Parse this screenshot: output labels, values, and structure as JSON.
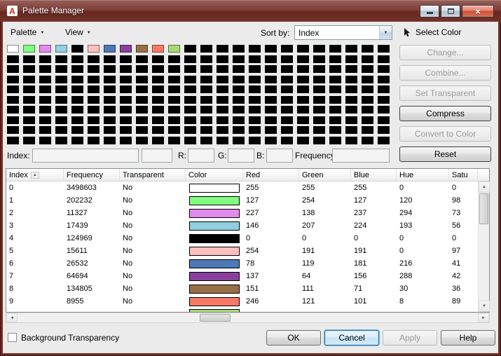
{
  "window": {
    "title": "Palette Manager",
    "icon_letter": "A"
  },
  "icons": {
    "dropdown": "▼",
    "sort_asc": "▲",
    "up": "▲",
    "down": "▼",
    "left": "◄",
    "right": "►",
    "close": "×"
  },
  "menubar": {
    "palette_label": "Palette",
    "view_label": "View",
    "sort_by_label": "Sort by:",
    "sort_value": "Index",
    "select_color_label": "Select Color"
  },
  "palette_grid": {
    "columns": 24,
    "rows": 10,
    "lead_colors": [
      "#FFFFFF",
      "#7FFE7F",
      "#E38AED",
      "#92CFE0",
      "#000000",
      "#FEBFBF",
      "#4E77B5",
      "#89409C",
      "#976F47",
      "#F67965",
      "#A8D878"
    ],
    "fill_color": "#000000"
  },
  "side_buttons": [
    {
      "label": "Change...",
      "enabled": false
    },
    {
      "label": "Combine...",
      "enabled": false
    },
    {
      "label": "Set Transparent",
      "enabled": false
    },
    {
      "label": "Compress",
      "enabled": true
    },
    {
      "label": "Convert to Color",
      "enabled": false
    },
    {
      "label": "Reset",
      "enabled": true
    }
  ],
  "info_bar": {
    "index_label": "Index:",
    "index_value": "",
    "index_count_value": "",
    "r_label": "R:",
    "r_value": "",
    "g_label": "G:",
    "g_value": "",
    "b_label": "B:",
    "b_value": "",
    "frequency_label": "Frequency:",
    "frequency_value": ""
  },
  "table": {
    "columns": [
      "Index",
      "Frequency",
      "Transparent",
      "Color",
      "Red",
      "Green",
      "Blue",
      "Hue",
      "Satu"
    ],
    "sort_column": "Index",
    "rows": [
      {
        "index": "0",
        "frequency": "3498603",
        "transparent": "No",
        "color": "#FFFFFF",
        "red": "255",
        "green": "255",
        "blue": "255",
        "hue": "0",
        "satu": "0"
      },
      {
        "index": "1",
        "frequency": "202232",
        "transparent": "No",
        "color": "#7FFE7F",
        "red": "127",
        "green": "254",
        "blue": "127",
        "hue": "120",
        "satu": "98"
      },
      {
        "index": "2",
        "frequency": "11327",
        "transparent": "No",
        "color": "#E38AED",
        "red": "227",
        "green": "138",
        "blue": "237",
        "hue": "294",
        "satu": "73"
      },
      {
        "index": "3",
        "frequency": "17439",
        "transparent": "No",
        "color": "#92CFE0",
        "red": "146",
        "green": "207",
        "blue": "224",
        "hue": "193",
        "satu": "56"
      },
      {
        "index": "4",
        "frequency": "124969",
        "transparent": "No",
        "color": "#000000",
        "red": "0",
        "green": "0",
        "blue": "0",
        "hue": "0",
        "satu": "0"
      },
      {
        "index": "5",
        "frequency": "15611",
        "transparent": "No",
        "color": "#FEBFBF",
        "red": "254",
        "green": "191",
        "blue": "191",
        "hue": "0",
        "satu": "97"
      },
      {
        "index": "6",
        "frequency": "26532",
        "transparent": "No",
        "color": "#4E77B5",
        "red": "78",
        "green": "119",
        "blue": "181",
        "hue": "216",
        "satu": "41"
      },
      {
        "index": "7",
        "frequency": "64694",
        "transparent": "No",
        "color": "#89409C",
        "red": "137",
        "green": "64",
        "blue": "156",
        "hue": "288",
        "satu": "42"
      },
      {
        "index": "8",
        "frequency": "134805",
        "transparent": "No",
        "color": "#976F47",
        "red": "151",
        "green": "111",
        "blue": "71",
        "hue": "30",
        "satu": "36"
      },
      {
        "index": "9",
        "frequency": "8955",
        "transparent": "No",
        "color": "#F67965",
        "red": "246",
        "green": "121",
        "blue": "101",
        "hue": "8",
        "satu": "89"
      }
    ],
    "partial_row_color": "#A8D878"
  },
  "footer": {
    "checkbox_label": "Background Transparency",
    "checkbox_checked": false,
    "buttons": [
      {
        "label": "OK",
        "state": "normal"
      },
      {
        "label": "Cancel",
        "state": "focused"
      },
      {
        "label": "Apply",
        "state": "disabled"
      },
      {
        "label": "Help",
        "state": "normal"
      }
    ]
  }
}
